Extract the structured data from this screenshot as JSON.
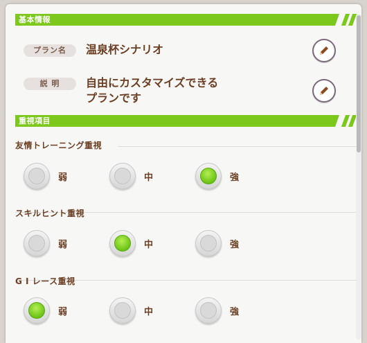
{
  "basic_info": {
    "section_title": "基本情報",
    "plan_name_label": "プラン名",
    "plan_name_value": "温泉杯シナリオ",
    "description_label": "説 明",
    "description_value": "自由にカスタマイズできる\nプランです"
  },
  "priority": {
    "section_title": "重視項目",
    "groups": [
      {
        "title": "友情トレーニング重視",
        "options": [
          "弱",
          "中",
          "強"
        ],
        "selected": "強"
      },
      {
        "title": "スキルヒント重視",
        "options": [
          "弱",
          "中",
          "強"
        ],
        "selected": "中"
      },
      {
        "title": "G I レース重視",
        "options": [
          "弱",
          "中",
          "強"
        ],
        "selected": "弱"
      }
    ]
  },
  "icons": {
    "edit": "pencil-icon"
  },
  "colors": {
    "accent_green": "#7cc81c",
    "text_brown": "#6b3e22",
    "edit_border": "#7b6a7c"
  }
}
